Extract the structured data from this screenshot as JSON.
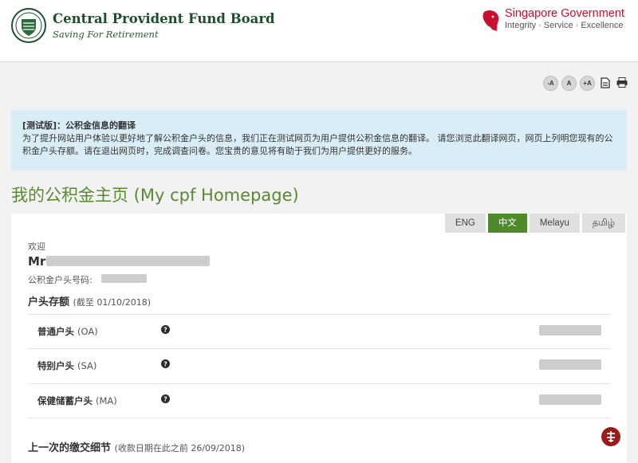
{
  "header": {
    "org_name": "Central Provident Fund Board",
    "org_tagline": "Saving For Retirement",
    "gov_name_part1": "Singapore",
    "gov_name_part2": "Government",
    "gov_motto": "Integrity · Service · Excellence"
  },
  "toolbar": {
    "decrease_font": "-A",
    "normal_font": "A",
    "increase_font": "+A",
    "icons": [
      "document-icon",
      "print-icon"
    ]
  },
  "notice": {
    "title": "[测试版]：公积金信息的翻译",
    "body": "为了提升网站用户体验以更好地了解公积金户头的信息，我们正在测试网页为用户提供公积金信息的翻译。 请您浏览此翻译网页，网页上列明您现有的公积金户头存额。请在退出网页时，完成调查问卷。您宝贵的意见将有助于我们为用户提供更好的服务。"
  },
  "page": {
    "title": "我的公积金主页 (My cpf Homepage)"
  },
  "language_tabs": [
    {
      "label": "ENG",
      "active": false
    },
    {
      "label": "中文",
      "active": true
    },
    {
      "label": "Melayu",
      "active": false
    },
    {
      "label": "தமிழ்",
      "active": false
    }
  ],
  "profile": {
    "welcome": "欢迎",
    "salutation": "Mr",
    "account_label": "公积金户头号码:"
  },
  "balances": {
    "heading": "户头存额",
    "as_of": "(截至 01/10/2018)",
    "accounts": [
      {
        "name": "普通户头",
        "code": "(OA)"
      },
      {
        "name": "特别户头",
        "code": "(SA)"
      },
      {
        "name": "保健储蓄户头",
        "code": "(MA)"
      }
    ]
  },
  "contribution": {
    "heading": "上一次的缴交细节",
    "note": "(收款日期在此之前 26/09/2018)"
  },
  "colors": {
    "brand_green": "#4e8a2a",
    "title_green": "#5a8a2f",
    "notice_bg": "#d9edf7",
    "sg_red": "#c8102e"
  }
}
